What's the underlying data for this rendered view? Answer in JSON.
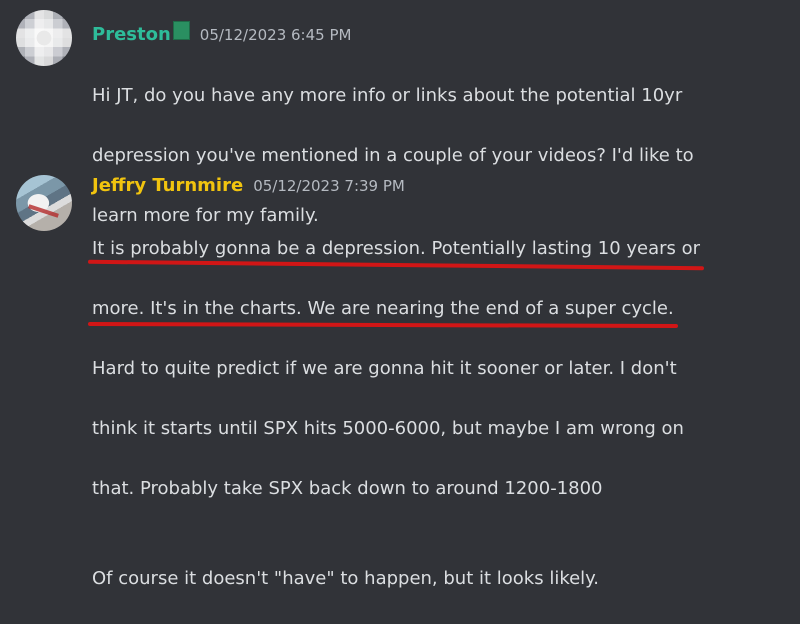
{
  "messages": [
    {
      "username": "Preston",
      "role_icon": "green-square-icon",
      "timestamp": "05/12/2023 6:45 PM",
      "lines": [
        "Hi JT, do you have any more info or links about the potential 10yr",
        "depression you've mentioned in a couple of your videos?  I'd like to",
        "learn more for my family."
      ]
    },
    {
      "username": "Jeffry Turnmire",
      "timestamp": "05/12/2023 7:39 PM",
      "lines": [
        "It is probably gonna be a depression. Potentially lasting 10 years or",
        "more.  It's in the charts.  We are nearing the end of a super cycle.",
        "Hard to quite predict if we are gonna hit it sooner or later.  I don't",
        "think it starts until SPX hits 5000-6000, but maybe I am wrong on",
        "that.  Probably take SPX back down to around 1200-1800",
        "",
        "Of course it doesn't \"have\" to happen, but it looks likely."
      ]
    }
  ],
  "colors": {
    "background": "#313338",
    "preston_name": "#2ebc9a",
    "jeffry_name": "#f1c40f",
    "text": "#dbdee1",
    "timestamp": "#b5bac1",
    "underline": "#d11616"
  }
}
